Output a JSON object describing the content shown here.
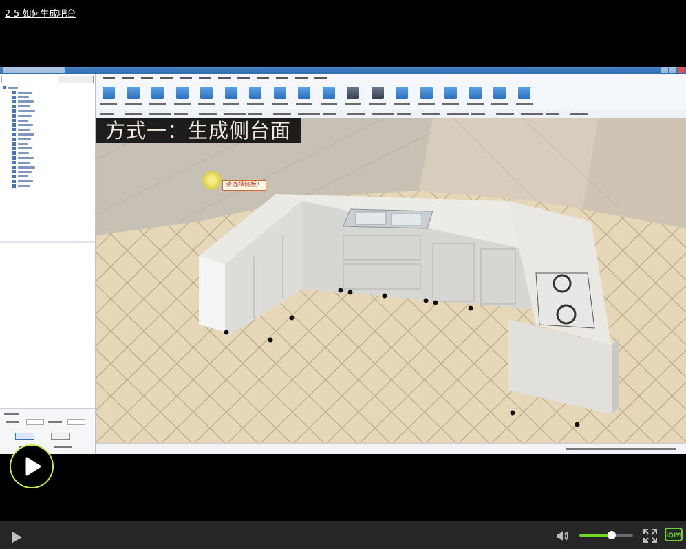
{
  "video": {
    "title": "2-5   如何生成吧台",
    "volume_level": 0.6
  },
  "app": {
    "caption": "方式一：生成侧台面",
    "tooltip": "请选择侧板！"
  },
  "logo": {
    "text": "iQIYI"
  },
  "colors": {
    "accent": "#72d51f",
    "caption_bg": "#1d1d1d",
    "titlebar": "#2f6db3"
  },
  "icons": [
    "play-icon",
    "volume-icon",
    "fullscreen-icon"
  ]
}
